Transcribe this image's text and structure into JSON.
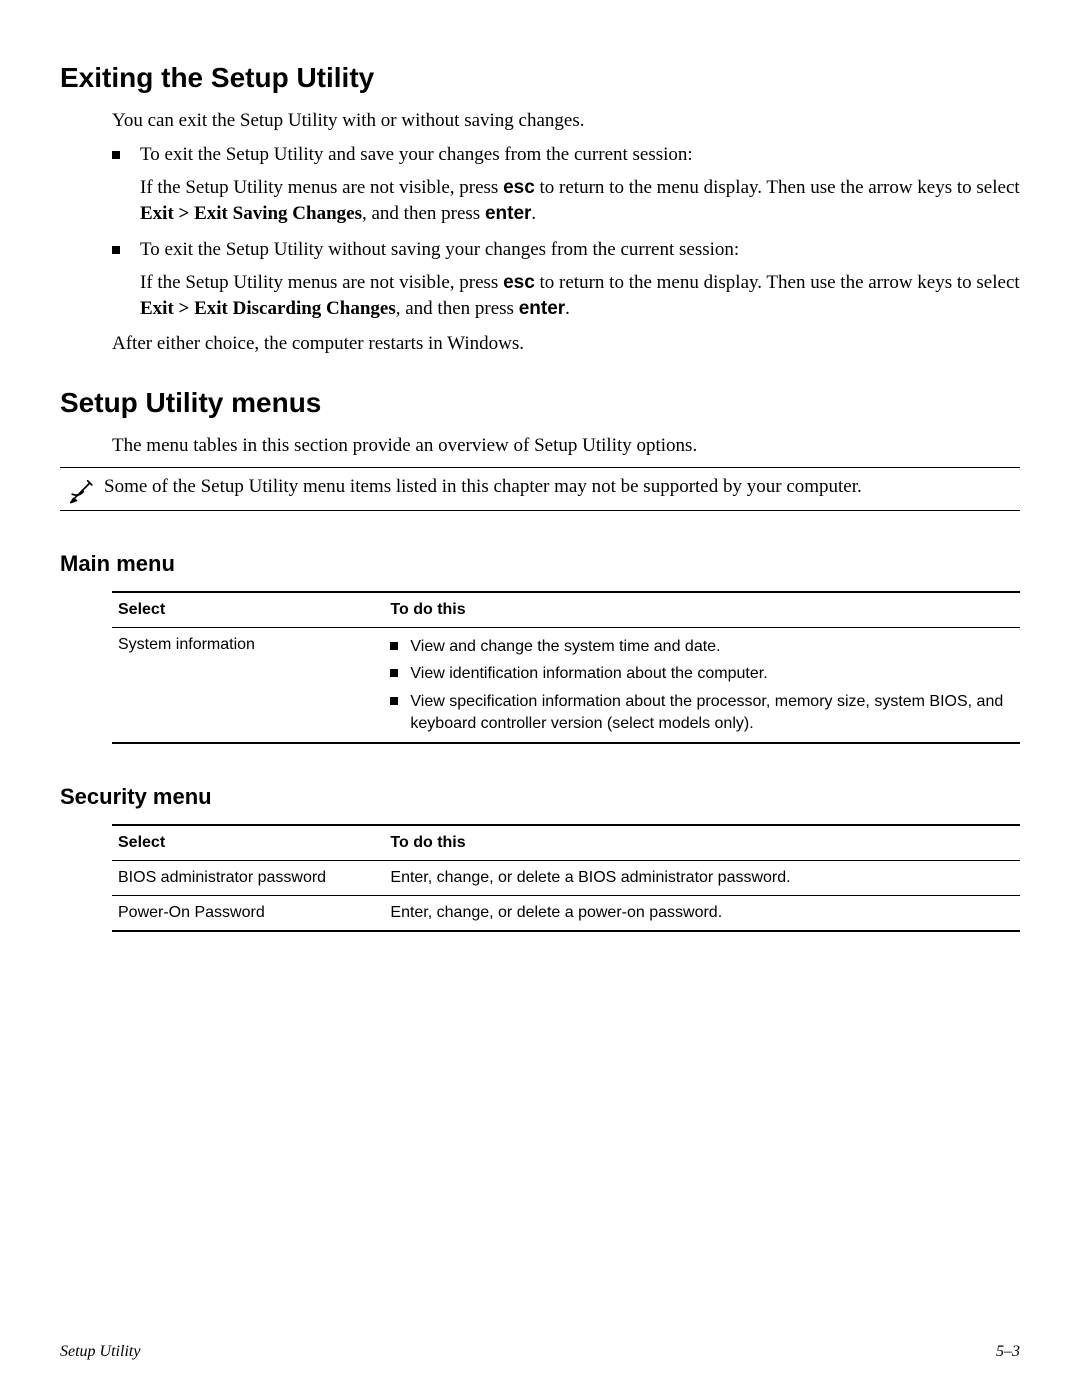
{
  "h1_exit": "Exiting the Setup Utility",
  "exit_intro": "You can exit the Setup Utility with or without saving changes.",
  "exit_b1": "To exit the Setup Utility and save your changes from the current session:",
  "exit_b1_sub_a": "If the Setup Utility menus are not visible, press ",
  "key_esc": "esc",
  "exit_b1_sub_b": " to return to the menu display. Then use the arrow keys to select ",
  "menu_exit_save": "Exit > Exit Saving Changes",
  "exit_b1_sub_c": ", and then press ",
  "key_enter": "enter",
  "period": ".",
  "exit_b2": "To exit the Setup Utility without saving your changes from the current session:",
  "exit_b2_sub_a": "If the Setup Utility menus are not visible, press ",
  "exit_b2_sub_b": " to return to the menu display. Then use the arrow keys to select ",
  "menu_exit_discard": "Exit > Exit Discarding Changes",
  "exit_b2_sub_c": ", and then press ",
  "exit_after": "After either choice, the computer restarts in Windows.",
  "h1_menus": "Setup Utility menus",
  "menus_intro": "The menu tables in this section provide an overview of Setup Utility options.",
  "note_text": "Some of the Setup Utility menu items listed in this chapter may not be supported by your computer.",
  "h2_main": "Main menu",
  "th_select": "Select",
  "th_todo": "To do this",
  "main_r1_select": "System information",
  "main_r1_b1": "View and change the system time and date.",
  "main_r1_b2": "View identification information about the computer.",
  "main_r1_b3": "View specification information about the processor, memory size, system BIOS, and keyboard controller version (select models only).",
  "h2_security": "Security menu",
  "sec_r1_select": "BIOS administrator password",
  "sec_r1_todo": "Enter, change, or delete a BIOS administrator password.",
  "sec_r2_select": "Power-On Password",
  "sec_r2_todo": "Enter, change, or delete a power-on password.",
  "footer_left": "Setup Utility",
  "footer_right": "5–3"
}
